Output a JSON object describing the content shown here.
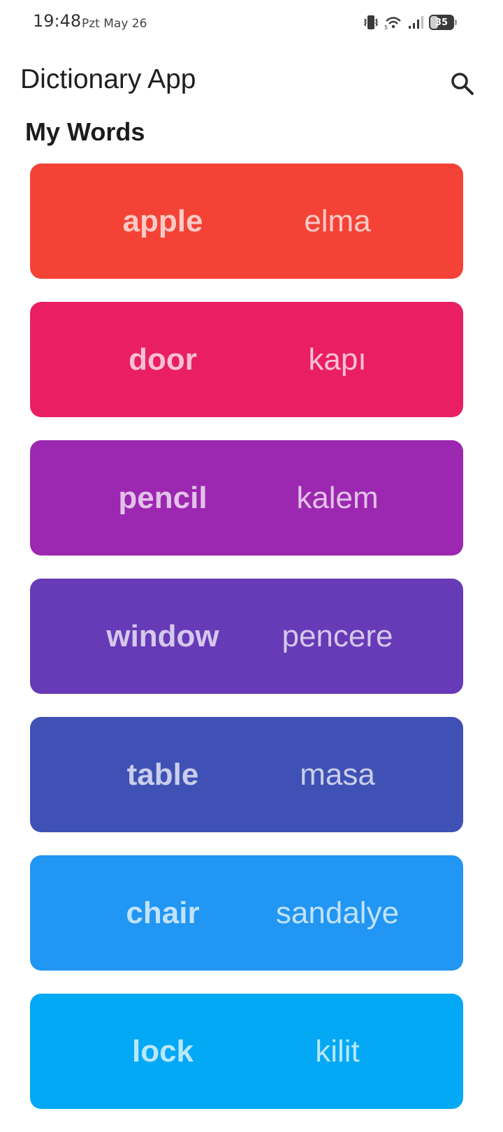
{
  "status_bar": {
    "time": "19:48",
    "date": "Pzt May 26",
    "battery_level": "35",
    "icons": [
      "vibrate-icon",
      "wifi-icon",
      "signal-icon",
      "battery-icon"
    ]
  },
  "app_bar": {
    "title": "Dictionary App",
    "search_icon": "search-icon"
  },
  "section": {
    "title": "My Words"
  },
  "words": [
    {
      "english": "apple",
      "turkish": "elma",
      "color": "#F44336"
    },
    {
      "english": "door",
      "turkish": "kapı",
      "color": "#E91E63"
    },
    {
      "english": "pencil",
      "turkish": "kalem",
      "color": "#9C27B0"
    },
    {
      "english": "window",
      "turkish": "pencere",
      "color": "#673AB7"
    },
    {
      "english": "table",
      "turkish": "masa",
      "color": "#3F51B5"
    },
    {
      "english": "chair",
      "turkish": "sandalye",
      "color": "#2196F3"
    },
    {
      "english": "lock",
      "turkish": "kilit",
      "color": "#03A9F4"
    }
  ]
}
